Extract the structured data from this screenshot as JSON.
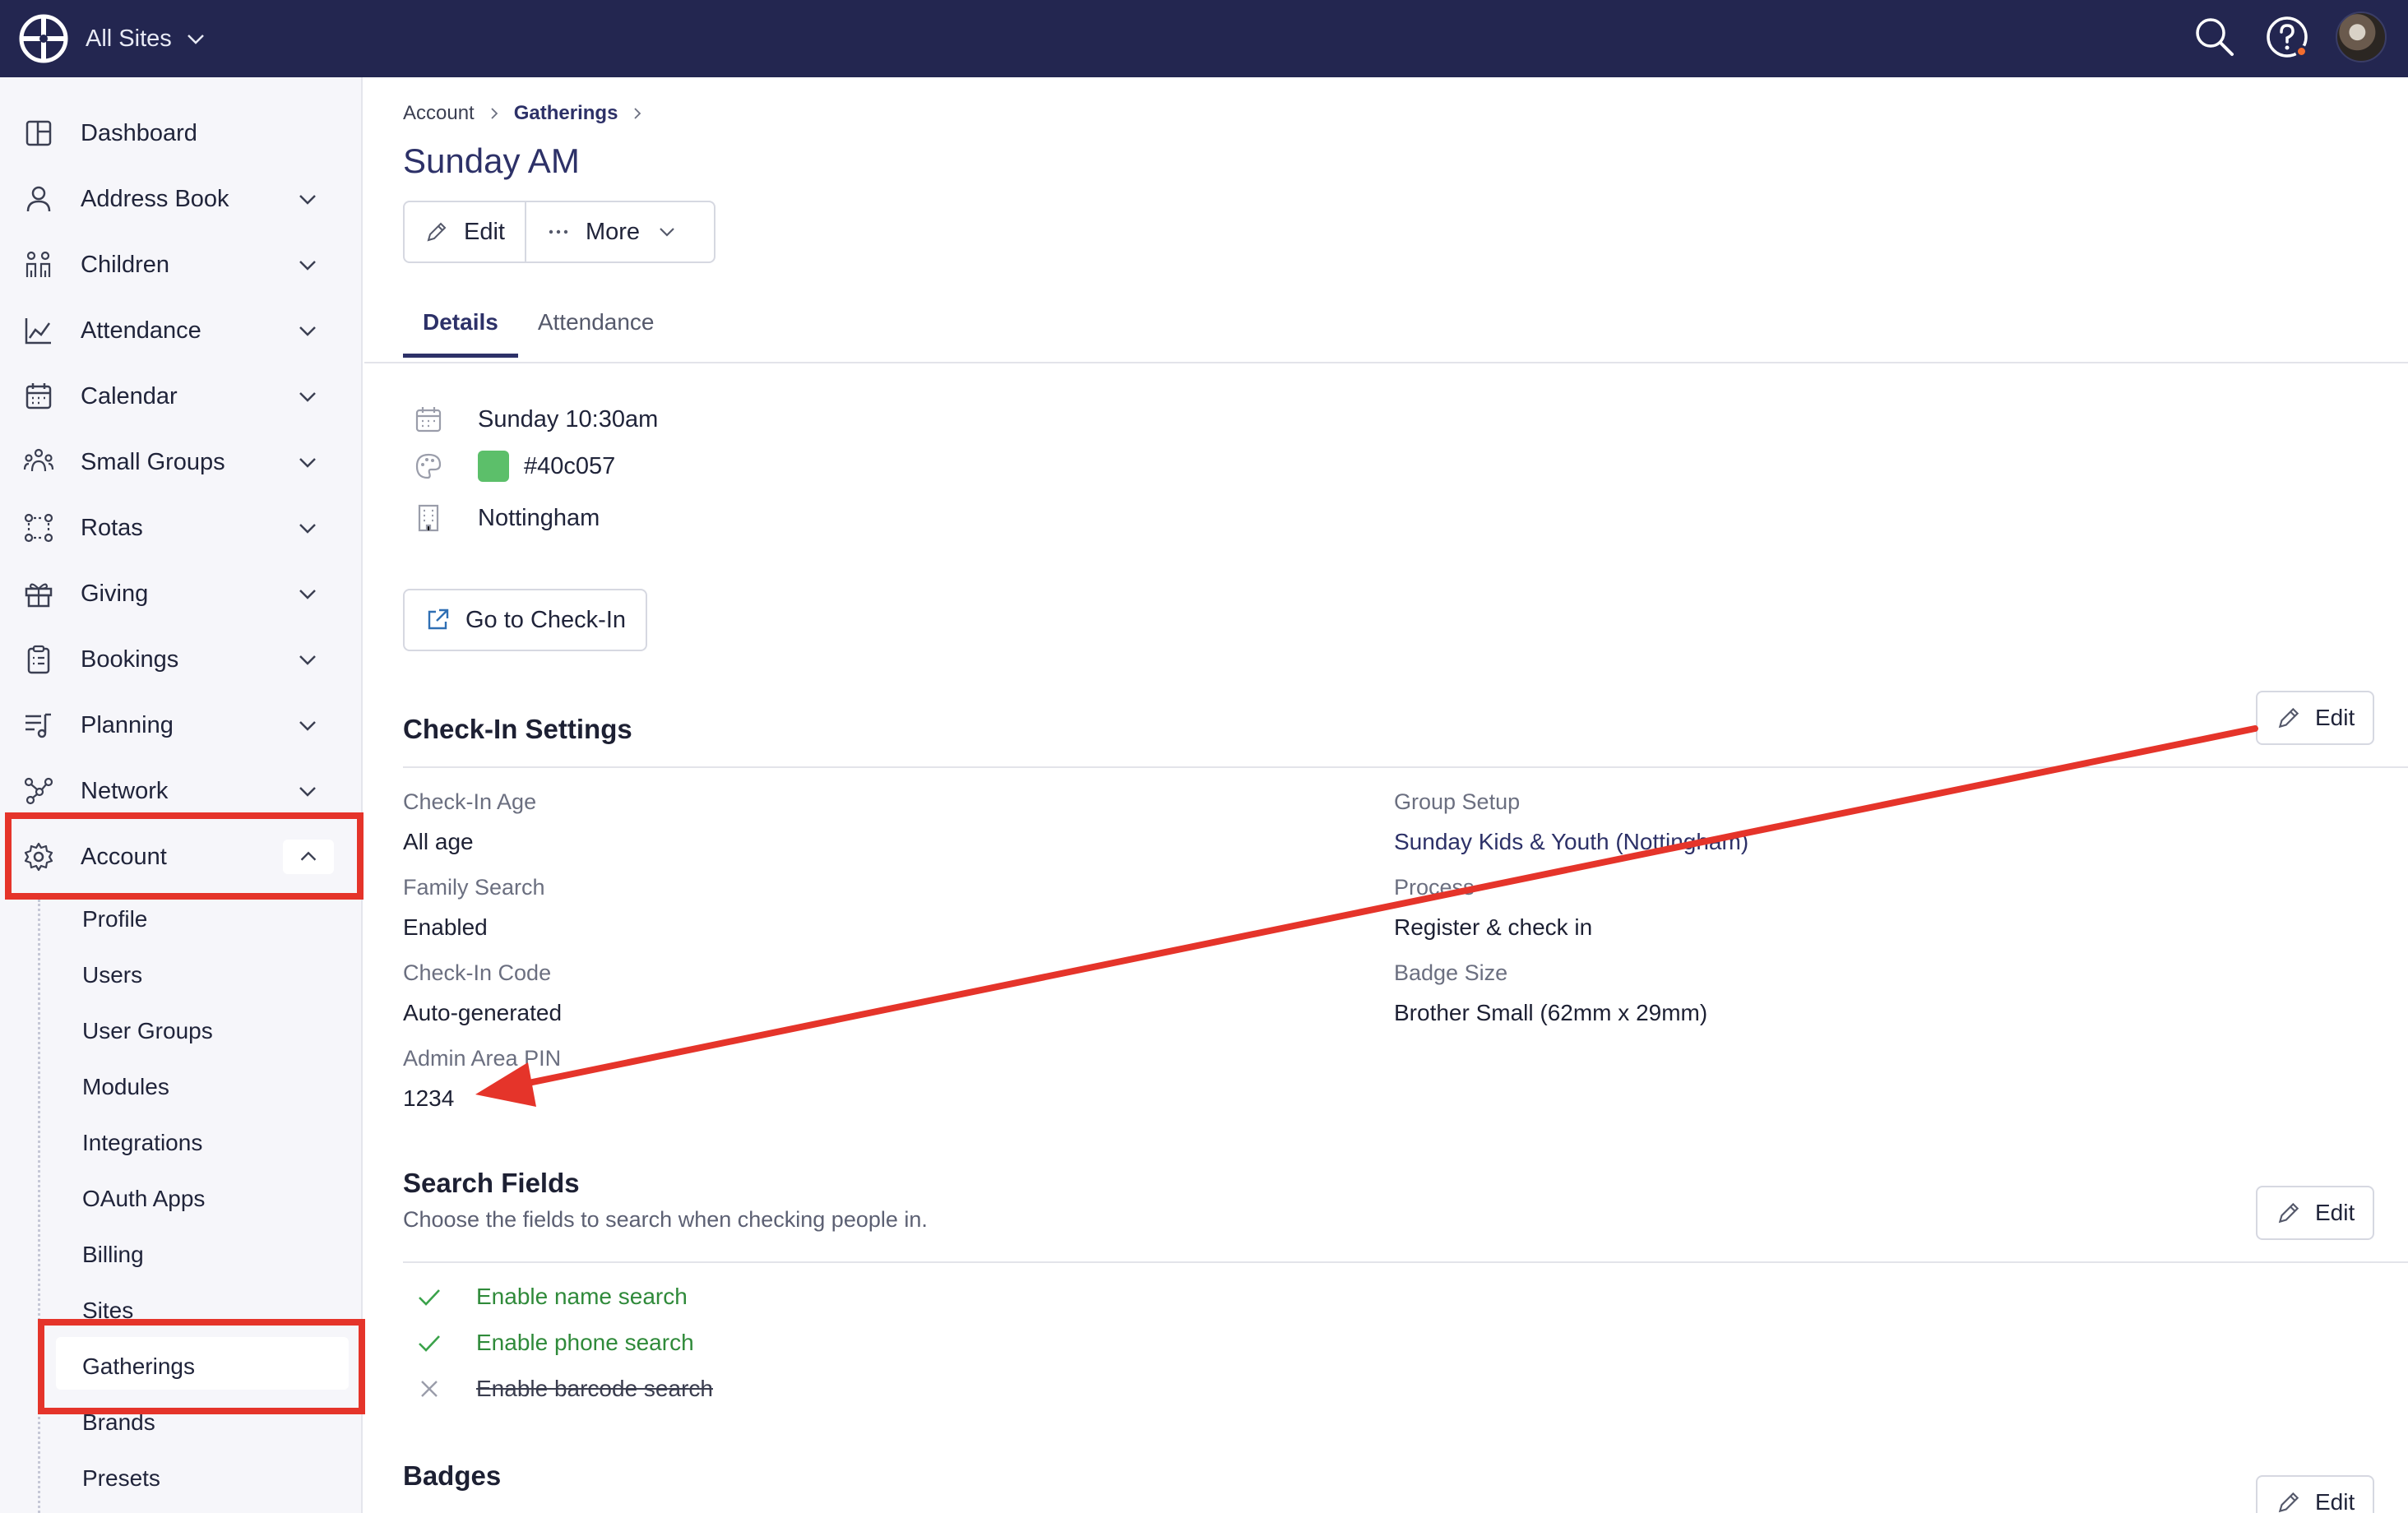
{
  "topbar": {
    "site_selector": "All Sites",
    "icons": [
      "brand-logo-icon",
      "search-icon",
      "help-icon",
      "avatar"
    ]
  },
  "sidebar": {
    "items": [
      {
        "label": "Dashboard",
        "icon": "dashboard-icon"
      },
      {
        "label": "Address Book",
        "icon": "person-icon"
      },
      {
        "label": "Children",
        "icon": "children-icon"
      },
      {
        "label": "Attendance",
        "icon": "chart-icon"
      },
      {
        "label": "Calendar",
        "icon": "calendar-icon"
      },
      {
        "label": "Small Groups",
        "icon": "group-icon"
      },
      {
        "label": "Rotas",
        "icon": "rotas-icon"
      },
      {
        "label": "Giving",
        "icon": "gift-icon"
      },
      {
        "label": "Bookings",
        "icon": "clipboard-icon"
      },
      {
        "label": "Planning",
        "icon": "music-list-icon"
      },
      {
        "label": "Network",
        "icon": "network-icon"
      },
      {
        "label": "Account",
        "icon": "gear-icon"
      }
    ],
    "account_subitems": [
      "Profile",
      "Users",
      "User Groups",
      "Modules",
      "Integrations",
      "OAuth Apps",
      "Billing",
      "Sites",
      "Gatherings",
      "Brands",
      "Presets"
    ],
    "active_subitem": "Gatherings"
  },
  "breadcrumb": {
    "root": "Account",
    "current": "Gatherings"
  },
  "page": {
    "title": "Sunday AM",
    "edit_label": "Edit",
    "more_label": "More",
    "tabs": [
      "Details",
      "Attendance"
    ],
    "active_tab": "Details"
  },
  "details": {
    "schedule": "Sunday 10:30am",
    "color": "#40c057",
    "site": "Nottingham",
    "checkin_button": "Go to Check-In"
  },
  "checkin_settings": {
    "title": "Check-In Settings",
    "edit_label": "Edit",
    "fields": [
      {
        "label": "Check-In Age",
        "value": "All age"
      },
      {
        "label": "Family Search",
        "value": "Enabled"
      },
      {
        "label": "Check-In Code",
        "value": "Auto-generated"
      },
      {
        "label": "Admin Area PIN",
        "value": "1234"
      },
      {
        "label": "Group Setup",
        "value": "Sunday Kids & Youth (Nottingham)"
      },
      {
        "label": "Process",
        "value": "Register & check in"
      },
      {
        "label": "Badge Size",
        "value": "Brother Small (62mm x 29mm)"
      }
    ]
  },
  "search_fields": {
    "title": "Search Fields",
    "description": "Choose the fields to search when checking people in.",
    "edit_label": "Edit",
    "options": [
      {
        "label": "Enable name search",
        "enabled": true
      },
      {
        "label": "Enable phone search",
        "enabled": true
      },
      {
        "label": "Enable barcode search",
        "enabled": false
      }
    ]
  },
  "badges": {
    "title": "Badges",
    "edit_label": "Edit"
  },
  "annotation_color": "#e5342a"
}
